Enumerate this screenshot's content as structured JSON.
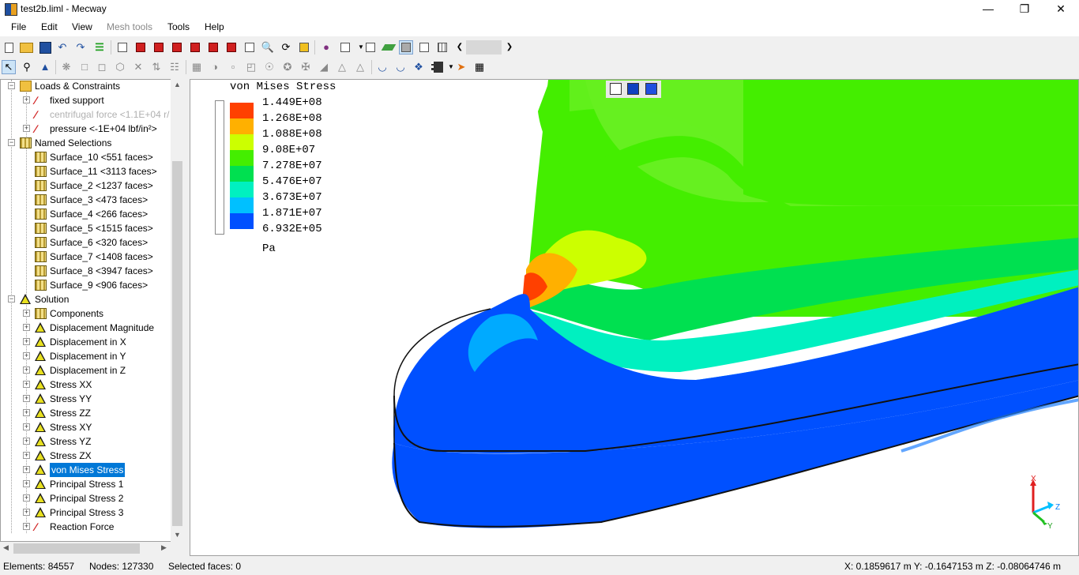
{
  "window": {
    "title": "test2b.liml - Mecway",
    "minimize": "—",
    "maximize": "❐",
    "close": "✕"
  },
  "menu": [
    "File",
    "Edit",
    "View",
    "Mesh tools",
    "Tools",
    "Help"
  ],
  "tree": {
    "items": [
      {
        "label": "Loads & Constraints",
        "icon": "folder-icon"
      },
      {
        "label": "fixed support",
        "icon": "fixed-support-icon"
      },
      {
        "label": "centrifugal force <1.1E+04 r/",
        "icon": "centrifugal-icon",
        "disabled": true
      },
      {
        "label": "pressure <-1E+04 lbf/in²>",
        "icon": "pressure-icon"
      },
      {
        "label": "Named Selections",
        "icon": "selection-folder-icon"
      },
      {
        "label": "Surface_10 <551 faces>",
        "icon": "surface-icon"
      },
      {
        "label": "Surface_11 <3113 faces>",
        "icon": "surface-icon"
      },
      {
        "label": "Surface_2 <1237 faces>",
        "icon": "surface-icon"
      },
      {
        "label": "Surface_3 <473 faces>",
        "icon": "surface-icon"
      },
      {
        "label": "Surface_4 <266 faces>",
        "icon": "surface-icon"
      },
      {
        "label": "Surface_5 <1515 faces>",
        "icon": "surface-icon"
      },
      {
        "label": "Surface_6 <320 faces>",
        "icon": "surface-icon"
      },
      {
        "label": "Surface_7 <1408 faces>",
        "icon": "surface-icon"
      },
      {
        "label": "Surface_8 <3947 faces>",
        "icon": "surface-icon"
      },
      {
        "label": "Surface_9 <906 faces>",
        "icon": "surface-icon"
      },
      {
        "label": "Solution",
        "icon": "solution-icon"
      },
      {
        "label": "Components",
        "icon": "components-icon"
      },
      {
        "label": "Displacement Magnitude",
        "icon": "result-icon"
      },
      {
        "label": "Displacement in X",
        "icon": "result-icon"
      },
      {
        "label": "Displacement in Y",
        "icon": "result-icon"
      },
      {
        "label": "Displacement in Z",
        "icon": "result-icon"
      },
      {
        "label": "Stress XX",
        "icon": "result-icon"
      },
      {
        "label": "Stress YY",
        "icon": "result-icon"
      },
      {
        "label": "Stress ZZ",
        "icon": "result-icon"
      },
      {
        "label": "Stress XY",
        "icon": "result-icon"
      },
      {
        "label": "Stress YZ",
        "icon": "result-icon"
      },
      {
        "label": "Stress ZX",
        "icon": "result-icon"
      },
      {
        "label": "von Mises Stress",
        "icon": "result-icon",
        "selected": true
      },
      {
        "label": "Principal Stress 1",
        "icon": "result-icon"
      },
      {
        "label": "Principal Stress 2",
        "icon": "result-icon"
      },
      {
        "label": "Principal Stress 3",
        "icon": "result-icon"
      },
      {
        "label": "Reaction Force",
        "icon": "reaction-force-icon"
      }
    ]
  },
  "legend": {
    "title": "von Mises Stress",
    "values": [
      "1.449E+08",
      "1.268E+08",
      "1.088E+08",
      "9.08E+07",
      "7.278E+07",
      "5.476E+07",
      "3.673E+07",
      "1.871E+07",
      "6.932E+05"
    ],
    "colors": [
      "#ff4000",
      "#ffb000",
      "#ccff00",
      "#44ee00",
      "#00e050",
      "#00f0c0",
      "#00c0ff",
      "#0050ff"
    ],
    "unit": "Pa"
  },
  "triad": {
    "x": "X",
    "y": "Y",
    "z": "Z"
  },
  "status": {
    "elements": "Elements: 84557",
    "nodes": "Nodes: 127330",
    "selected": "Selected faces: 0",
    "coords": "X: 0.1859617 m Y: -0.1647153 m Z: -0.08064746 m"
  }
}
